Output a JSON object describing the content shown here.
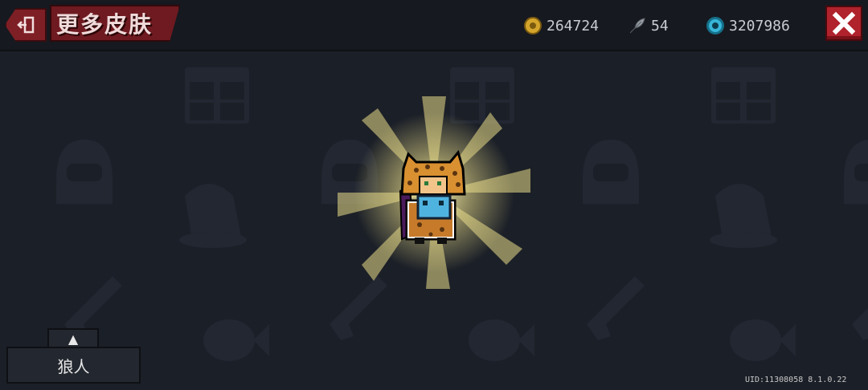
{
  "header": {
    "back_icon": "exit-door-icon",
    "title": "更多皮肤",
    "close_icon": "close-x-icon"
  },
  "currencies": [
    {
      "icon": "gold-coin-icon",
      "value": "264724"
    },
    {
      "icon": "fish-feather-icon",
      "value": "54"
    },
    {
      "icon": "gem-icon",
      "value": "3207986"
    }
  ],
  "hero": {
    "icon": "leopard-hood-knight-sprite"
  },
  "skin_selector": {
    "expand_icon": "▲",
    "name": "狼人"
  },
  "footer": {
    "uid": "UID:11308058 8.1.0.22"
  },
  "colors": {
    "accent_red": "#b0222c",
    "title_plate": "#6e1a20",
    "background": "#1b1f27",
    "glow": "#f5eaa0"
  }
}
